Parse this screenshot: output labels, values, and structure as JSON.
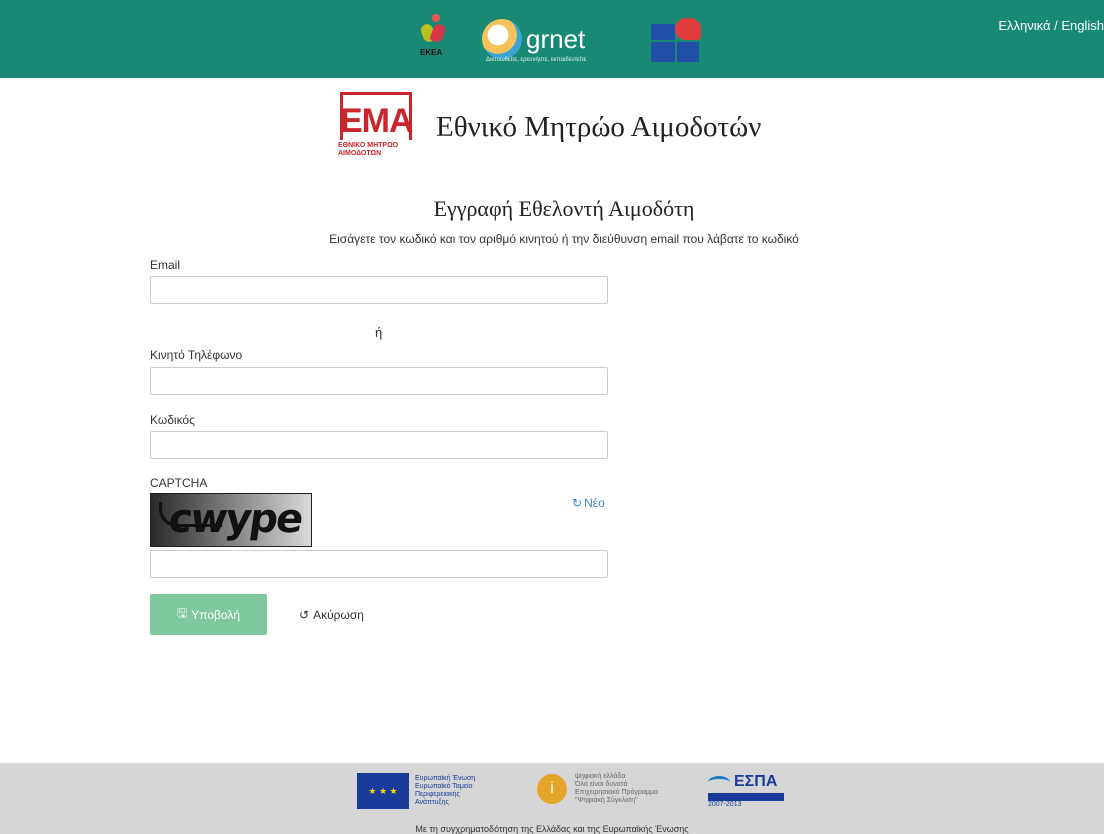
{
  "top_bar": {
    "language_switch": "Ελληνικά / English",
    "logos": {
      "ekea": "ΕΚΕΑ",
      "grnet": "grnet",
      "grnet_subtitle": "Δικτυωθείτε, ερευνήστε, εκπαιδευτείτε"
    }
  },
  "brand": {
    "logo_text": "ΕΜΑ",
    "logo_subtext": "ΕΘΝΙΚΟ ΜΗΤΡΩΟ ΑΙΜΟΔΟΤΩΝ",
    "title": "Εθνικό Μητρώο Αιμοδοτών"
  },
  "form": {
    "heading": "Εγγραφή Εθελοντή Αιμοδότη",
    "instructions": "Εισάγετε τον κωδικό και τον αριθμό κινητού ή την διεύθυνση email που λάβατε το κωδικό",
    "email_label": "Email",
    "email_value": "",
    "or_text": "ή",
    "phone_label": "Κινητό Τηλέφωνο",
    "phone_value": "",
    "code_label": "Κωδικός",
    "code_value": "",
    "captcha_label": "CAPTCHA",
    "captcha_image_text": "cwype",
    "captcha_refresh": "Νέο",
    "captcha_value": "",
    "submit_label": "Υποβολή",
    "cancel_label": "Ακύρωση"
  },
  "footer": {
    "eu_text": [
      "Ευρωπαϊκή Ένωση",
      "Ευρωπαϊκό Ταμείο",
      "Περιφερειακής",
      "Ανάπτυξης"
    ],
    "digital_text": [
      "ψηφιακή ελλάδα",
      "Όλα είναι δυνατά",
      "Επιχειρησιακό Πρόγραμμα",
      "\"Ψηφιακή Σύγκλιση\""
    ],
    "espa_text": "ΕΣΠΑ",
    "espa_years": "2007-2013",
    "note": "Με τη συγχρηματοδότηση της Ελλάδας και της Ευρωπαϊκής Ένωσης"
  },
  "colors": {
    "top_bar": "#188a74",
    "submit_button": "#7fc79f",
    "link": "#3a86c8",
    "footer": "#d6d6d6",
    "brand_red": "#c9252c"
  }
}
